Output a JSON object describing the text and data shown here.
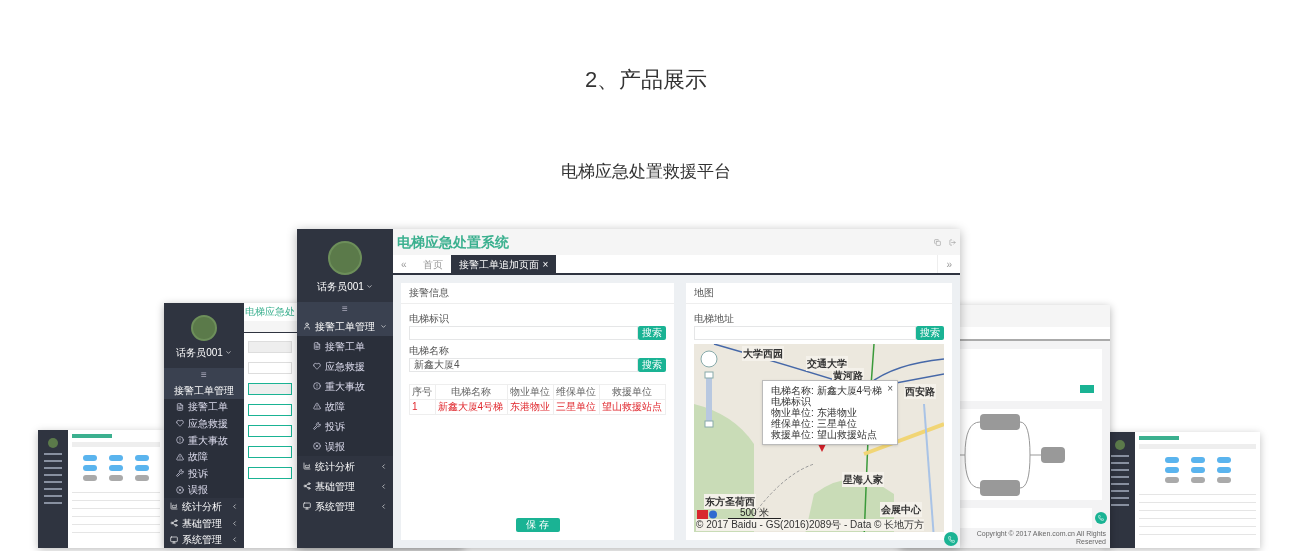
{
  "heading": "2、产品展示",
  "subheading": "电梯应急处置救援平台",
  "main_window": {
    "sidebar": {
      "user": "话务员001",
      "menu_toggle": "≡",
      "menu": [
        {
          "label": "接警工单管理",
          "expanded": true,
          "children": [
            {
              "label": "接警工单"
            },
            {
              "label": "应急救援"
            },
            {
              "label": "重大事故"
            },
            {
              "label": "故障"
            },
            {
              "label": "投诉"
            },
            {
              "label": "误报"
            }
          ]
        },
        {
          "label": "统计分析",
          "expanded": false
        },
        {
          "label": "基础管理",
          "expanded": false
        },
        {
          "label": "系统管理",
          "expanded": false
        }
      ]
    },
    "title": "电梯应急处置系统",
    "tab_prev": "«",
    "tab_next": "»",
    "tabs": [
      {
        "label": "首页",
        "selected": false
      },
      {
        "label": "接警工单追加页面",
        "selected": true,
        "close": "×"
      }
    ],
    "alarm_panel": {
      "title": "接警信息",
      "fields": [
        {
          "label": "电梯标识",
          "button": "搜索"
        },
        {
          "label": "电梯名称",
          "value": "新鑫大厦4",
          "button": "搜索"
        }
      ],
      "table": {
        "columns": [
          "序号",
          "电梯名称",
          "物业单位",
          "维保单位",
          "救援单位"
        ],
        "rows": [
          [
            "1",
            "新鑫大厦4号梯",
            "东港物业",
            "三星单位",
            "望山救援站点"
          ]
        ]
      },
      "save_button": "保 存"
    },
    "map_panel": {
      "title": "地图",
      "field": {
        "label": "电梯地址",
        "button": "搜索"
      },
      "map": {
        "labels": [
          "大学西园",
          "交通大学",
          "黄河路",
          "西安路",
          "星海人家",
          "会展中心",
          "东方圣荷西"
        ],
        "popup": {
          "close": "×",
          "lines": [
            "电梯名称: 新鑫大厦4号梯",
            "电梯标识",
            "物业单位: 东港物业",
            "维保单位: 三星单位",
            "救援单位: 望山救援站点"
          ]
        },
        "scale": "500 米",
        "copyright": "© 2017 Baidu - GS(2016)2089号 - Data © 长地万方"
      }
    }
  },
  "back_window": {
    "title": "电梯应急处",
    "user": "话务员001",
    "menu_toggle": "≡",
    "menu": [
      {
        "label": "接警工单管理",
        "expanded": true,
        "children": [
          {
            "label": "接警工单"
          },
          {
            "label": "应急救援"
          },
          {
            "label": "重大事故"
          },
          {
            "label": "故障"
          },
          {
            "label": "投诉"
          },
          {
            "label": "误报"
          }
        ]
      },
      {
        "label": "统计分析",
        "expanded": false
      },
      {
        "label": "基础管理",
        "expanded": false
      },
      {
        "label": "系统管理",
        "expanded": false
      }
    ]
  },
  "right_window": {
    "copyright": "Copyright © 2017 Aiken.com.cn All Rights Reserved"
  }
}
